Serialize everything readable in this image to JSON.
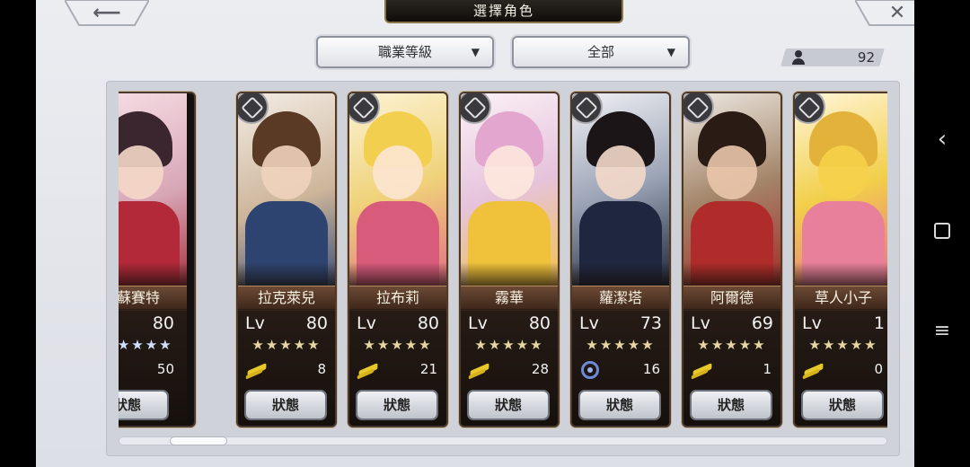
{
  "header": {
    "title": "選擇角色",
    "back_icon": "arrow-left-icon",
    "close_icon": "close-x-icon"
  },
  "filters": {
    "class_dropdown": {
      "label": "職業等級",
      "caret": "▼"
    },
    "scope_dropdown": {
      "label": "全部",
      "caret": "▼"
    }
  },
  "count": {
    "icon": "person-icon",
    "value": "92"
  },
  "status_label": "狀態",
  "lv_label": "Lv",
  "characters": [
    {
      "name": "蘇賽特",
      "lv": "80",
      "stars": "★★★★★",
      "element": "feather-icon",
      "points": "50",
      "class_icon": "none"
    },
    {
      "name": "拉克萊兒",
      "lv": "80",
      "stars": "★★★★★",
      "element": "feather-icon",
      "points": "8",
      "class_icon": "spear-icon"
    },
    {
      "name": "拉布莉",
      "lv": "80",
      "stars": "★★★★★",
      "element": "feather-icon",
      "points": "21",
      "class_icon": "gauntlet-icon"
    },
    {
      "name": "霧華",
      "lv": "80",
      "stars": "★★★★★",
      "element": "feather-icon",
      "points": "28",
      "class_icon": "hammer-icon"
    },
    {
      "name": "蘿潔塔",
      "lv": "73",
      "stars": "★★★★★",
      "element": "swirl-icon",
      "points": "16",
      "class_icon": "whip-icon"
    },
    {
      "name": "阿爾德",
      "lv": "69",
      "stars": "★★★★★",
      "element": "feather-icon",
      "points": "1",
      "class_icon": "sword-icon"
    },
    {
      "name": "草人小子",
      "lv": "1",
      "stars": "★★★★★",
      "element": "feather-icon",
      "points": "0",
      "class_icon": "gauntlet-icon"
    },
    {
      "name": "",
      "lv": "",
      "stars": "★★★★★",
      "element": "feather-icon",
      "points": "",
      "class_icon": "sword-icon"
    }
  ],
  "system_nav": {
    "back": "‹",
    "menu": "≡"
  },
  "colors": {
    "name_plate": "#5a3b2a",
    "panel": "#cfd2d9",
    "star": "#e6d6a4"
  }
}
